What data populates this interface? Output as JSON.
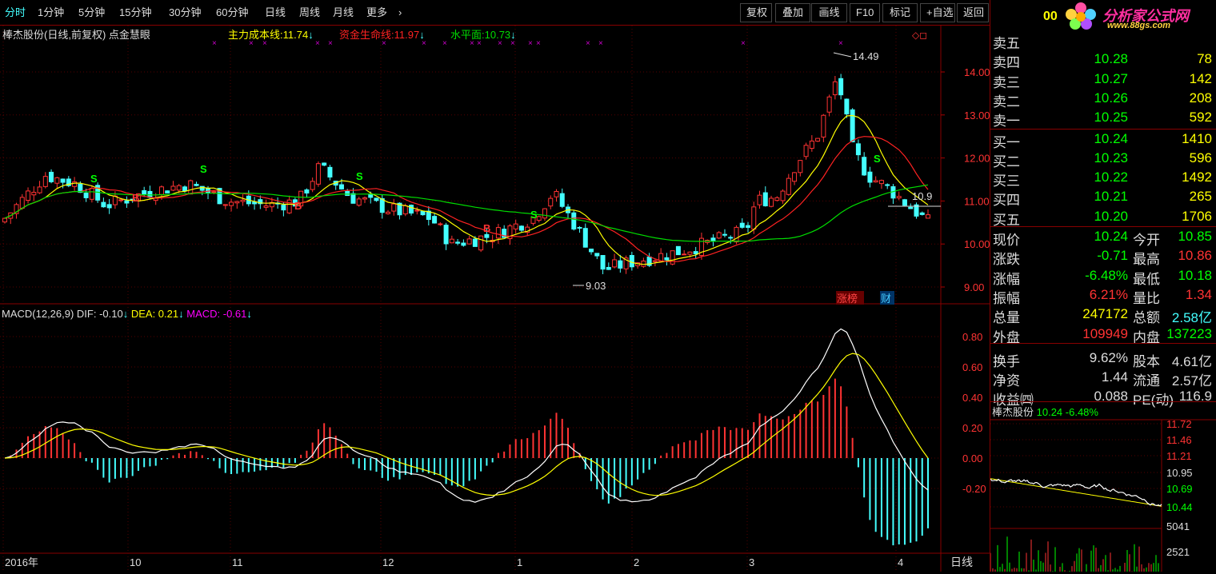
{
  "toolbar": {
    "left": [
      "分时",
      "1分钟",
      "5分钟",
      "15分钟",
      "30分钟",
      "60分钟",
      "日线",
      "周线",
      "月线",
      "更多",
      "›"
    ],
    "right": [
      "复权",
      "叠加",
      "画线",
      "F10",
      "标记",
      "+自选",
      "返回"
    ]
  },
  "chart": {
    "title": "棒杰股份(日线,前复权) 点金慧眼",
    "ind1_label": "主力成本线:",
    "ind1_value": "11.74",
    "ind2_label": "资金生命线:",
    "ind2_value": "11.97",
    "ind3_label": "水平面:",
    "ind3_value": "10.73",
    "price_ticks": [
      "14.00",
      "13.00",
      "12.00",
      "11.00",
      "10.00",
      "9.00"
    ],
    "high_label": "14.49",
    "low_label": "9.03",
    "last_label": "10.9",
    "signal_buy": "B",
    "signal_sell": "S",
    "badge1": "涨榜",
    "badge2": "财",
    "macd_title": "MACD(12,26,9)",
    "dif_label": "DIF:",
    "dif_value": "-0.10",
    "dea_label": "DEA:",
    "dea_value": "0.21",
    "macd_label": "MACD:",
    "macd_value": "-0.61",
    "macd_ticks": [
      "0.80",
      "0.60",
      "0.40",
      "0.20",
      "0.00",
      "-0.20"
    ],
    "date_labels": [
      "2016年",
      "10",
      "11",
      "12",
      "1",
      "2",
      "3",
      "4"
    ],
    "period": "日线"
  },
  "chart_data": {
    "type": "candlestick",
    "price_axis": [
      9.0,
      14.0
    ],
    "macd_axis": [
      -0.2,
      0.8
    ],
    "high": 14.49,
    "low": 9.03,
    "macd": {
      "dif": -0.1,
      "dea": 0.21,
      "macd": -0.61
    }
  },
  "quote": {
    "code": "00",
    "logo": "分析家公式网",
    "logo_url": "www.88gs.com",
    "asks": [
      {
        "label": "卖五",
        "price": "",
        "vol": ""
      },
      {
        "label": "卖四",
        "price": "10.28",
        "vol": "78"
      },
      {
        "label": "卖三",
        "price": "10.27",
        "vol": "142"
      },
      {
        "label": "卖二",
        "price": "10.26",
        "vol": "208"
      },
      {
        "label": "卖一",
        "price": "10.25",
        "vol": "592"
      }
    ],
    "bids": [
      {
        "label": "买一",
        "price": "10.24",
        "vol": "1410"
      },
      {
        "label": "买二",
        "price": "10.23",
        "vol": "596"
      },
      {
        "label": "买三",
        "price": "10.22",
        "vol": "1492"
      },
      {
        "label": "买四",
        "price": "10.21",
        "vol": "265"
      },
      {
        "label": "买五",
        "price": "10.20",
        "vol": "1706"
      }
    ],
    "f": [
      [
        "现价",
        "10.24",
        "今开",
        "10.85"
      ],
      [
        "涨跌",
        "-0.71",
        "最高",
        "10.86"
      ],
      [
        "涨幅",
        "-6.48%",
        "最低",
        "10.18"
      ],
      [
        "振幅",
        "6.21%",
        "量比",
        "1.34"
      ],
      [
        "总量",
        "247172",
        "总额",
        "2.58亿"
      ],
      [
        "外盘",
        "109949",
        "内盘",
        "137223"
      ],
      [
        "换手",
        "9.62%",
        "股本",
        "4.61亿"
      ],
      [
        "净资",
        "1.44",
        "流通",
        "2.57亿"
      ],
      [
        "收益㈣",
        "0.088",
        "PE(动)",
        "116.9"
      ]
    ],
    "mini_name": "棒杰股份",
    "mini_price": "10.24",
    "mini_chg": "-6.48%",
    "mini_ticks": [
      "11.72",
      "11.46",
      "11.21",
      "10.95",
      "10.69",
      "10.44",
      "5041",
      "2521"
    ]
  },
  "colors": {
    "up": "#ff3333",
    "down": "#44ffff",
    "ma1": "#ffff00",
    "ma2": "#ff2222",
    "ma3": "#00dd00",
    "dif": "#ffffff",
    "dea": "#ffff00"
  }
}
